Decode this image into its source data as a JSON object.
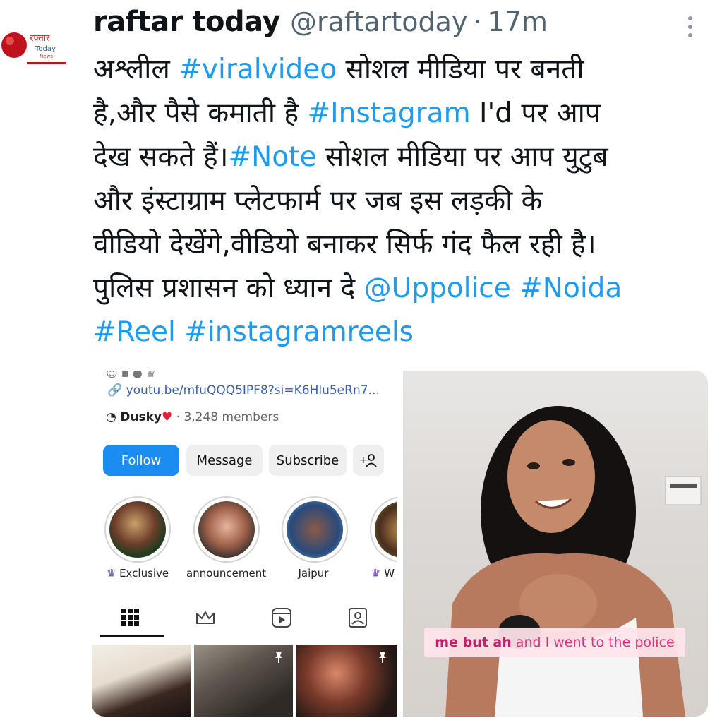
{
  "tweet": {
    "display_name": "raftar today",
    "handle": "@raftartoday",
    "separator": "·",
    "time": "17m",
    "lines": [
      [
        {
          "t": "अश्लील "
        },
        {
          "t": "#viralvideo",
          "link": true
        },
        {
          "t": " सोशल मीडिया पर बनती"
        }
      ],
      [
        {
          "t": "है,और पैसे कमाती है "
        },
        {
          "t": "#Instagram",
          "link": true
        },
        {
          "t": " I'd पर आप"
        }
      ],
      [
        {
          "t": "देख सकते हैं।"
        },
        {
          "t": "#Note",
          "link": true
        },
        {
          "t": " सोशल मीडिया पर आप युटुब"
        }
      ],
      [
        {
          "t": "और इंस्टाग्राम प्लेटफार्म पर जब इस लड़की के"
        }
      ],
      [
        {
          "t": "वीडियो देखेंगे,वीडियो बनाकर सिर्फ गंद फैल रही है।"
        }
      ],
      [
        {
          "t": "पुलिस प्रशासन को ध्यान दे "
        },
        {
          "t": "@Uppolice",
          "link": true
        },
        {
          "t": " "
        },
        {
          "t": "#Noida",
          "link": true
        }
      ],
      [
        {
          "t": "#Reel",
          "link": true
        },
        {
          "t": " "
        },
        {
          "t": "#instagramreels",
          "link": true
        }
      ]
    ],
    "link_color": "#1d9bf0",
    "text_color": "#0f1419",
    "muted_color": "#536471"
  },
  "avatar": {
    "logo_text": "रफ़्तार",
    "logo_sub": "Today",
    "logo_tag": "News"
  },
  "media_left": {
    "link": "youtu.be/mfuQQQ5IPF8?si=K6Hlu5eRn7...",
    "channel_name": "Dusky",
    "channel_members": "· 3,248 members",
    "buttons": {
      "follow": "Follow",
      "message": "Message",
      "subscribe": "Subscribe",
      "add_user": "+"
    },
    "highlights": [
      {
        "label": "Exclusive"
      },
      {
        "label": "announcement"
      },
      {
        "label": "Jaipur"
      },
      {
        "label": "W"
      }
    ],
    "follow_color": "#1b8cf0"
  },
  "media_right": {
    "caption_bold": "me but ah",
    "caption_rest": " and I went to the police"
  }
}
